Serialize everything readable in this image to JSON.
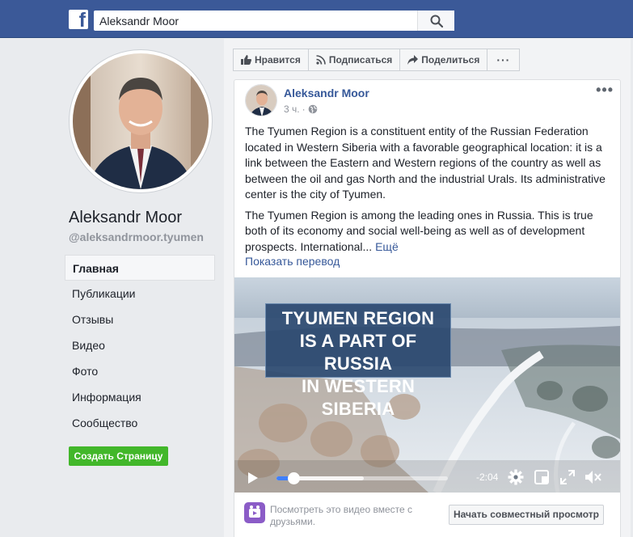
{
  "header": {
    "logo": "f",
    "search_value": "Aleksandr Moor"
  },
  "profile": {
    "name": "Aleksandr Moor",
    "handle": "@aleksandrmoor.tyumen"
  },
  "nav": {
    "items": [
      "Главная",
      "Публикации",
      "Отзывы",
      "Видео",
      "Фото",
      "Информация",
      "Сообщество"
    ],
    "active_index": 0
  },
  "create_page_label": "Создать Страницу",
  "actions": {
    "like": "Нравится",
    "follow": "Подписаться",
    "share": "Поделиться",
    "more": "···"
  },
  "post": {
    "author": "Aleksandr Moor",
    "time": "3 ч.",
    "menu": "•••",
    "paragraph1": "The Tyumen Region is a constituent entity of the Russian Federation located in Western Siberia with a favorable geographical location: it is a link between the Eastern and Western regions of the country as well as between the oil and gas North and the industrial Urals. Its administrative center is the city of Tyumen.",
    "paragraph2": "The Tyumen Region is among the leading ones in Russia. This is true both of its economy and social well-being as well as of development prospects. International...",
    "more_link": "Ещё",
    "translate": "Показать перевод"
  },
  "video": {
    "title_line1": "TYUMEN REGION",
    "title_line2": "IS A PART OF RUSSIA",
    "title_line3": "IN WESTERN SIBERIA",
    "time_remaining": "-2:04",
    "progress": 0.1,
    "buffered": 0.51
  },
  "watch_party": {
    "text": "Посмотреть это видео вместе с друзьями.",
    "button": "Начать совместный просмотр"
  },
  "colors": {
    "brand": "#3b5998",
    "link": "#365899",
    "green": "#42b72a",
    "progress": "#4080ff"
  }
}
